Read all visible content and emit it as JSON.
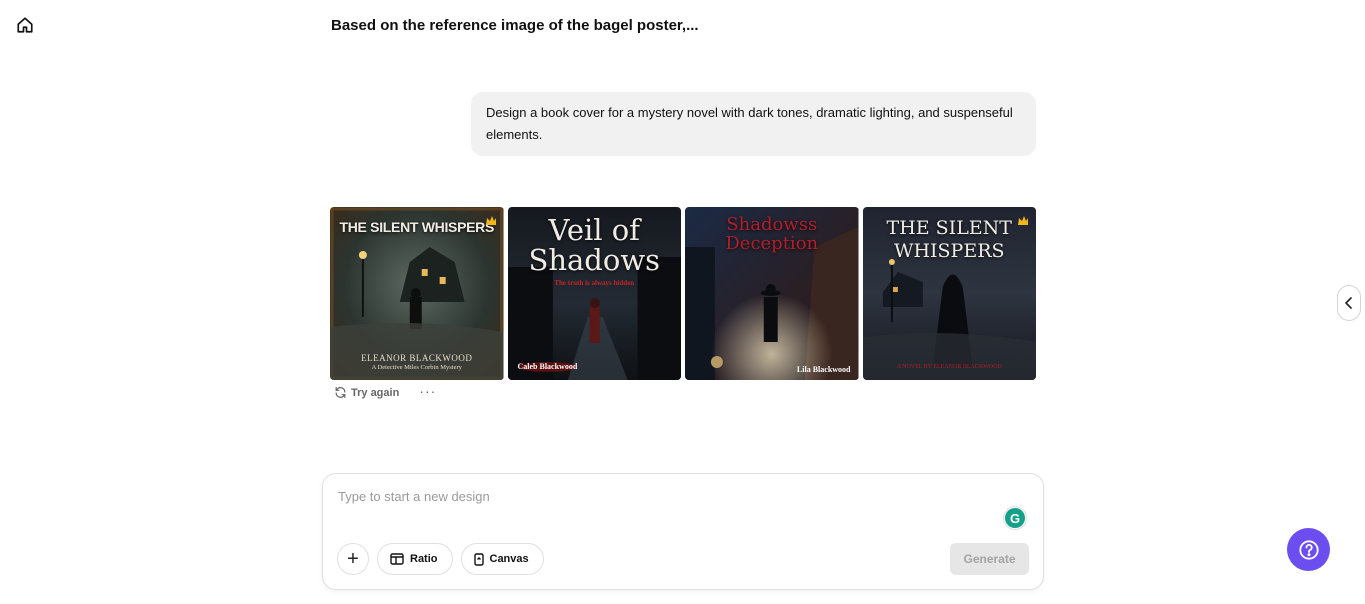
{
  "header": {
    "title": "Based on the reference image of the bagel poster,..."
  },
  "conversation": {
    "prompt": "Design a book cover for a mystery novel with dark tones, dramatic lighting, and suspenseful elements."
  },
  "results": [
    {
      "title": "THE SILENT WHISPERS",
      "author": "ELEANOR BLACKWOOD",
      "subtitle": "A Detective Miles Corbin Mystery"
    },
    {
      "title_line1": "Veil of",
      "title_line2": "Shadows",
      "tagline": "The truth is always hidden",
      "author": "Caleb Blackwood"
    },
    {
      "title_line1": "Shadowss",
      "title_line2": "Deception",
      "author": "Lila Blackwood"
    },
    {
      "title_line1": "THE SILENT",
      "title_line2": "WHISPERS",
      "tagline": "A NOVEL BY ELEANOR BLACKWOOD"
    }
  ],
  "actions": {
    "try_again": "Try again",
    "more": "···"
  },
  "composer": {
    "placeholder": "Type to start a new design",
    "ratio_label": "Ratio",
    "canvas_label": "Canvas",
    "generate_label": "Generate",
    "plus": "+"
  },
  "colors": {
    "accent": "#6c4ef0",
    "bubble": "#f1f1f2",
    "grammarly": "#15a08a"
  }
}
